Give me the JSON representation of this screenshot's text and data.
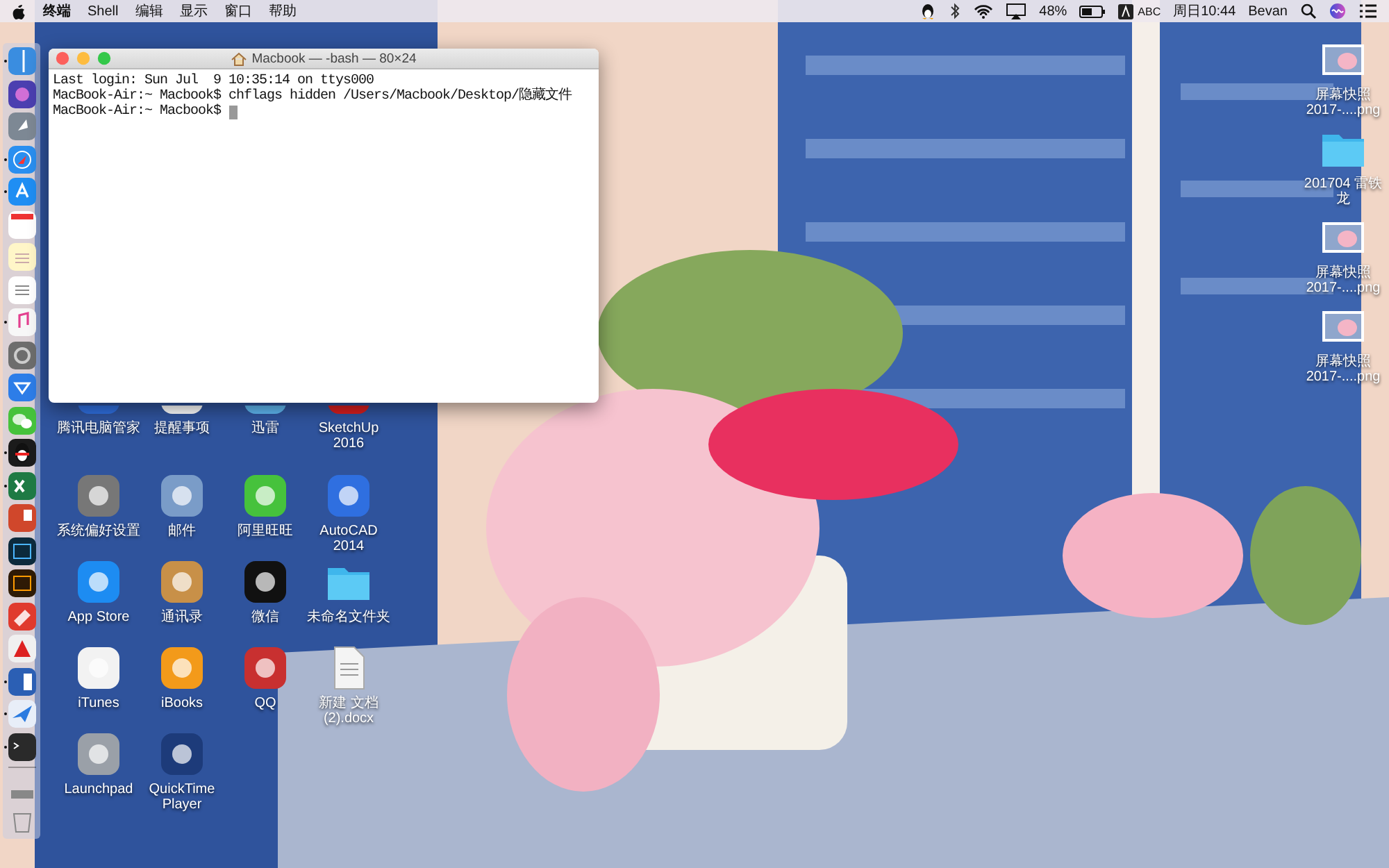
{
  "menu_bar": {
    "app_name": "终端",
    "menus": [
      "Shell",
      "编辑",
      "显示",
      "窗口",
      "帮助"
    ],
    "battery_percent": "48%",
    "input_source": "ABC",
    "clock": "周日10:44",
    "user": "Bevan"
  },
  "terminal": {
    "title": "Macbook — -bash — 80×24",
    "lines": [
      "Last login: Sun Jul  9 10:35:14 on ttys000",
      "MacBook-Air:~ Macbook$ chflags hidden /Users/Macbook/Desktop/隐藏文件",
      "MacBook-Air:~ Macbook$ "
    ]
  },
  "dock": {
    "items": [
      {
        "running": true
      },
      {
        "running": false
      },
      {
        "running": false
      },
      {
        "running": true
      },
      {
        "running": true
      },
      {
        "running": false
      },
      {
        "running": false
      },
      {
        "running": false
      },
      {
        "running": true
      },
      {
        "running": false
      },
      {
        "running": false
      },
      {
        "running": false
      },
      {
        "running": true
      },
      {
        "running": true
      },
      {
        "running": false
      },
      {
        "running": false
      },
      {
        "running": false
      },
      {
        "running": false
      },
      {
        "running": false
      },
      {
        "running": true
      },
      {
        "running": true
      },
      {
        "running": true
      },
      {
        "running": false
      },
      {
        "running": false
      }
    ]
  },
  "desktop_columns": [
    [
      {
        "label": "腾讯电脑管家",
        "kind": "app"
      },
      {
        "label": "系统偏好设置",
        "kind": "app"
      },
      {
        "label": "App Store",
        "kind": "app"
      },
      {
        "label": "iTunes",
        "kind": "app"
      },
      {
        "label": "Launchpad",
        "kind": "app"
      }
    ],
    [
      {
        "label": "提醒事项",
        "kind": "app"
      },
      {
        "label": "邮件",
        "kind": "app"
      },
      {
        "label": "通讯录",
        "kind": "app"
      },
      {
        "label": "iBooks",
        "kind": "app"
      },
      {
        "label": "QuickTime Player",
        "kind": "app"
      }
    ],
    [
      {
        "label": "迅雷",
        "kind": "app"
      },
      {
        "label": "阿里旺旺",
        "kind": "app"
      },
      {
        "label": "微信",
        "kind": "app"
      },
      {
        "label": "QQ",
        "kind": "app"
      }
    ],
    [
      {
        "label": "SketchUp 2016",
        "kind": "app"
      },
      {
        "label": "AutoCAD 2014",
        "kind": "app"
      },
      {
        "label": "未命名文件夹",
        "kind": "folder"
      },
      {
        "label": "新建 文档 (2).docx",
        "kind": "document"
      }
    ]
  ],
  "desktop_right": [
    {
      "label": "屏幕快照 2017-....png",
      "kind": "screenshot"
    },
    {
      "label": "201704 雷铁龙",
      "kind": "folder"
    },
    {
      "label": "屏幕快照 2017-....png",
      "kind": "screenshot"
    },
    {
      "label": "屏幕快照 2017-....png",
      "kind": "screenshot"
    }
  ]
}
